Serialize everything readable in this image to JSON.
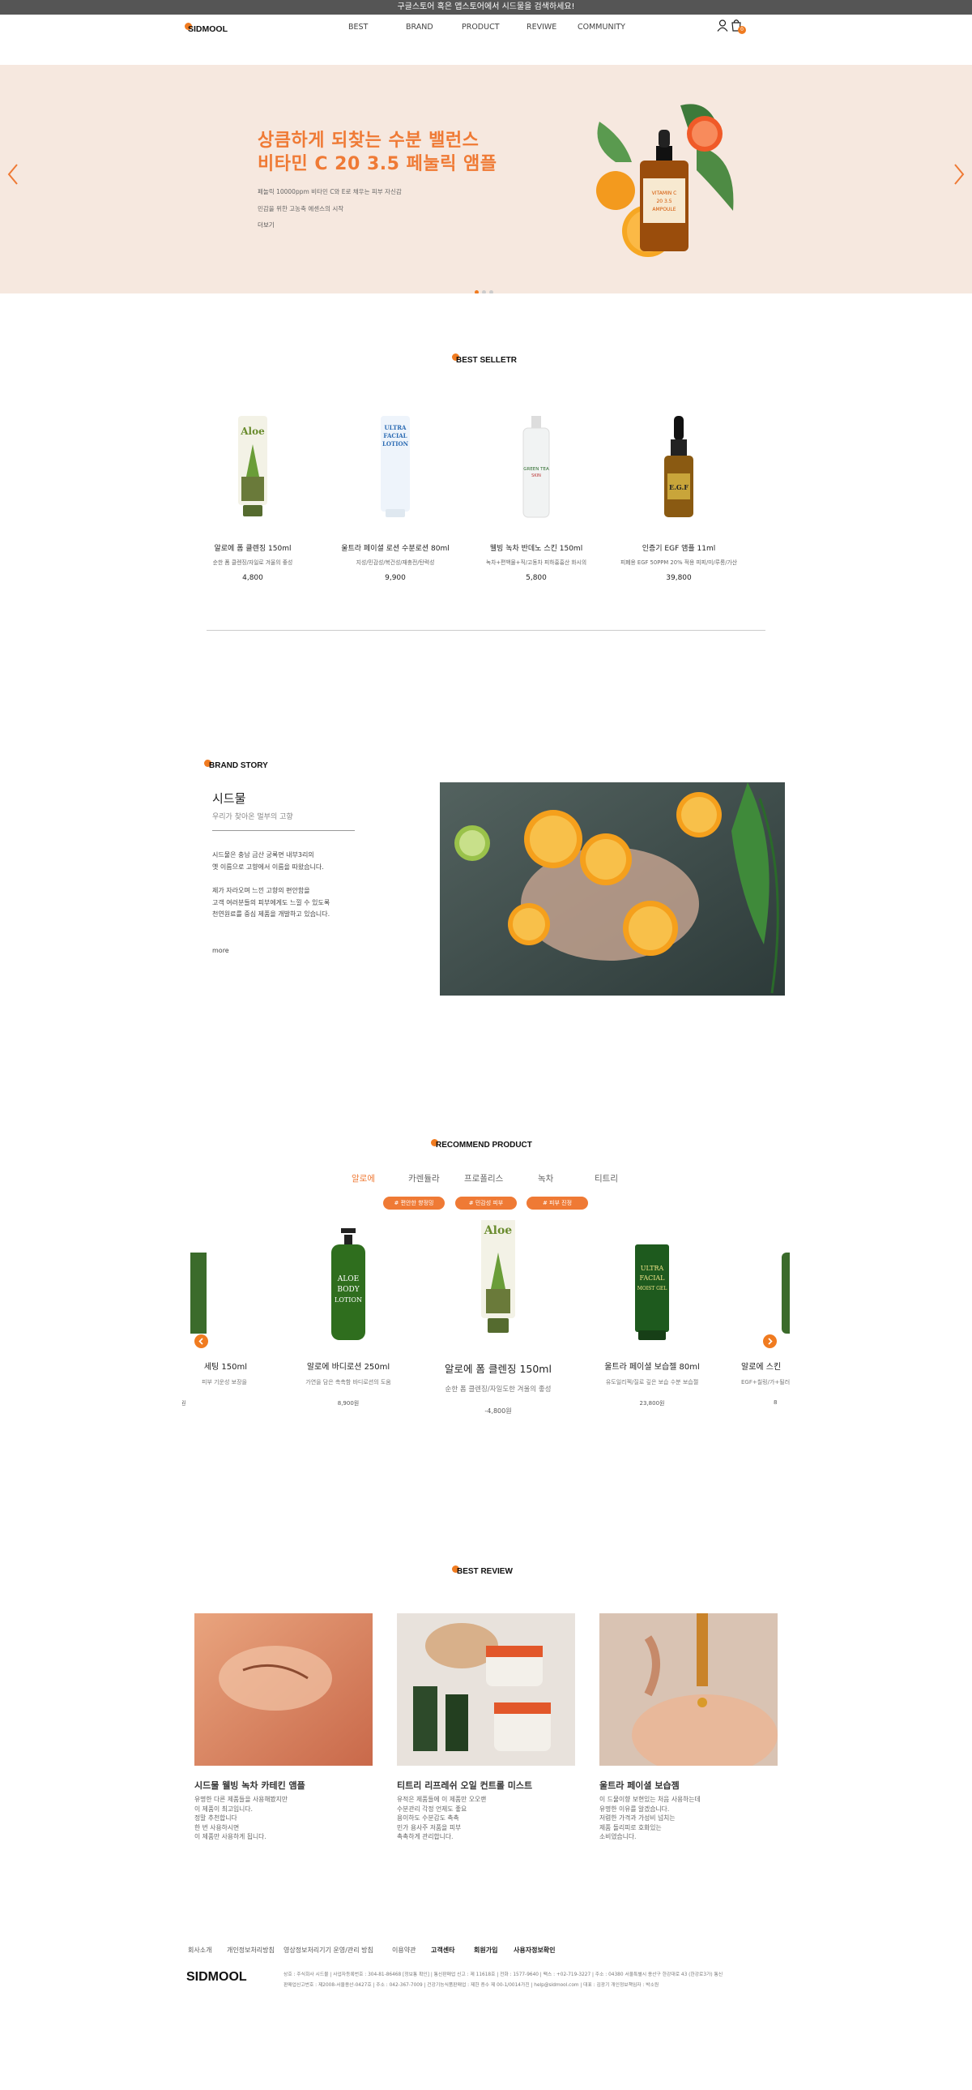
{
  "notice": "구글스토어 혹은 앱스토어에서 시드물을 검색하세요!",
  "header": {
    "logo": "SIDMOOL",
    "nav": [
      "BEST",
      "BRAND",
      "PRODUCT",
      "REVIWE",
      "COMMUNITY"
    ],
    "cart_count": "0"
  },
  "hero": {
    "title_line1": "상큼하게 되찾는 수분 밸런스",
    "title_line2": "비타민 C 20 3.5  페눌릭 앰플",
    "desc1": "페놀릭 10000ppm 비타민 C와 E로 채우는 피부 자신감",
    "desc2": "민감을 위한 고농축 에센스의 시작",
    "more": "더보기",
    "bottle_label": "VITAMIN C 20 3.5 AMPOULE",
    "accent": "#ef7a35",
    "bg": "#f6e8df"
  },
  "best": {
    "title": "BEST SELLETR",
    "items": [
      {
        "name": "알로에 폼 클렌징 150ml",
        "desc": "순한 폼 클렌징/자일로 겨울의 좋성",
        "price": "4,800",
        "label": "Aloe"
      },
      {
        "name": "울트라 페이셜 로션 수분로션 80ml",
        "desc": "지성/민감성/복건성/재충전/탄력성",
        "price": "9,900",
        "label": "ULTRA FACIAL LOTION"
      },
      {
        "name": "웰빙 녹차 반데노 스킨 150ml",
        "desc": "녹차+편백물+직/고동차 피하흉흉산 화시의",
        "price": "5,800",
        "label": "GREEN TEA SKIN"
      },
      {
        "name": "인증기 EGF 앰플 11ml",
        "desc": "피폐용 EGF 50PPM 20% 적용 피피/미/루롱/가산",
        "price": "39,800",
        "label": "E.G.F"
      }
    ]
  },
  "brand": {
    "title": "BRAND STORY",
    "heading": "시드물",
    "sub": "우리가 찾아온 멀부의 고향",
    "p1": [
      "시드물은 충남 금산 궁록면 내부3리의",
      "옛 이름으로 고향에서 이름을 따왔습니다."
    ],
    "p2": [
      "제가 자라오며 느낀 고향의 편안함을",
      "고객 여러분들의 피부에게도 느낄 수 있도록",
      "천연원료를 중심 제품을 개발하고 있습니다."
    ],
    "more": "more"
  },
  "recommend": {
    "title": "RECOMMEND PRODUCT",
    "tabs": [
      "알로에",
      "카렌듈라",
      "프로폴리스",
      "녹차",
      "티트리"
    ],
    "pills": [
      "# 편안한 향정밍",
      "# 민감성 피부",
      "# 피부 진정"
    ],
    "items": [
      {
        "name": "세팅 150ml",
        "desc": "피부 기운성 보장을",
        "price": "원"
      },
      {
        "name": "알로에 바디로션 250ml",
        "desc": "가연을 담은 촉촉함 바디로션의 도움",
        "price": "8,900원",
        "label": "ALOE BODY LOTION"
      },
      {
        "name": "알로에 폼 클렌징 150ml",
        "desc": "순한 폼 클렌징/자일도한 겨울의 좋성",
        "price": "-4,800원",
        "label": "Aloe"
      },
      {
        "name": "울트라 페이셜 보습젤 80ml",
        "desc": "유도일리젝/질로 깊은 보습 수분 보습젤",
        "price": "23,800원",
        "label": "ULTRA FACIAL MOIST GEL"
      },
      {
        "name": "알로에 스킨",
        "desc": "EGF+칠링/가+될러스",
        "price": "8"
      }
    ]
  },
  "review": {
    "title": "BEST REVIEW",
    "items": [
      {
        "title": "시드물 웰빙 녹차 카테킨 앰플",
        "text": "유명한 다른 제품들을 사용해봤지만\n이 제품이 최고입니다.\n정말 추천합니다\n한 번 사용하시면\n이 제품만 사용하게 됩니다."
      },
      {
        "title": "티트리 리프레쉬 오일 컨트롤 미스트",
        "text": "유적은 제품들에 이 제품만 오오랜\n수분관리 각정 언제도 좋요\n용이하도 수분감도 촉촉\n민가 용사주 저품을 피부\n촉촉하게 관리합니다."
      },
      {
        "title": "울트라 페이셜 보습젬",
        "text": "이 드물이향 보현있는 처음 사용하는데\n유명한 이유를 알겠습니다.\n저렴한 가격과 가성비 넘치는\n제품 돌리피로 호화있는\n소비였습니다."
      }
    ]
  },
  "footer": {
    "links": [
      "회사소개",
      "개인정보처리방침",
      "영상정보처리기기 운영/관리 방침",
      "이용약관",
      "고객센타",
      "회원가입",
      "사용자정보확인"
    ],
    "logo": "SIDMOOL",
    "info1": "상호 : 주식회사 시드물 | 사업자등록번호 : 304-81-86468 [정보통 확인] | 통신판매업 신고 : 제 11618호 | 전화 : 1577-9640 | 팩스 : +02-719-3227 | 주소 : 04380 서울특별시 용산구 한강대로 43 (한강로3가) 통신",
    "info2": "판매업신고번호 : 제2008-서울용산-0427호 | 주소 : 042-367-7009 | 건강기능식품판매업 : 제한 증수 제 00-1/0014가진 | help@sidmool.com | 대표 : 김광기 개인정보책임자 : 박소원"
  }
}
